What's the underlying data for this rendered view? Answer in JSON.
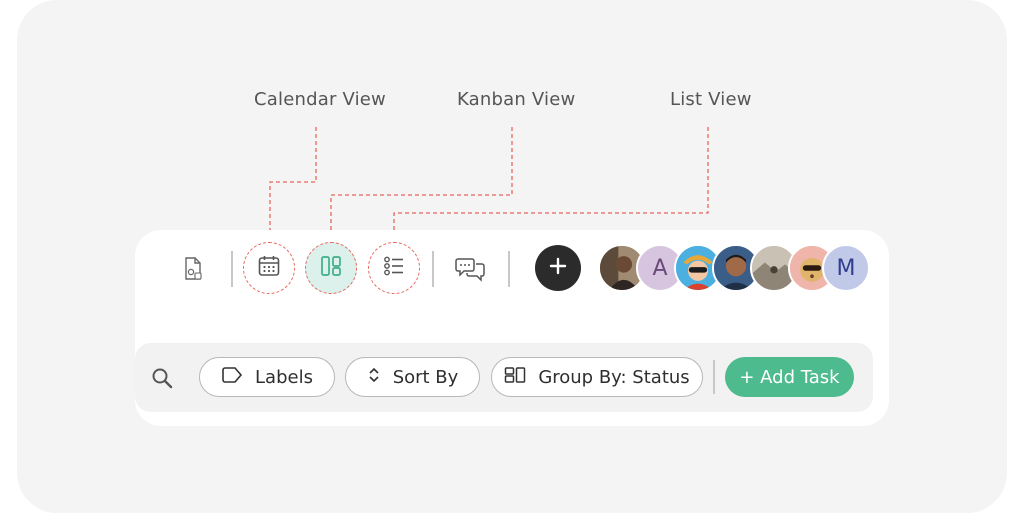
{
  "callouts": {
    "calendar": "Calendar View",
    "kanban": "Kanban View",
    "list": "List View"
  },
  "header_bar": {
    "icons": [
      "document-icon",
      "calendar-icon",
      "kanban-icon",
      "list-icon",
      "chat-icon",
      "plus-icon"
    ],
    "active_view": "kanban"
  },
  "avatars": [
    {
      "kind": "photo",
      "initial": "",
      "bg": "#7b6553"
    },
    {
      "kind": "initial",
      "initial": "A",
      "bg": "#d7c4de",
      "fg": "#6a4a7b"
    },
    {
      "kind": "photo",
      "initial": "",
      "bg": "#3fa5d6"
    },
    {
      "kind": "photo",
      "initial": "",
      "bg": "#3b5f88"
    },
    {
      "kind": "photo",
      "initial": "",
      "bg": "#b9b3a8"
    },
    {
      "kind": "photo",
      "initial": "",
      "bg": "#e6a79c"
    },
    {
      "kind": "initial",
      "initial": "M",
      "bg": "#c1c9e8",
      "fg": "#2f3e8f"
    }
  ],
  "toolbar": {
    "labels": "Labels",
    "sort_by": "Sort By",
    "group_by": "Group By: Status",
    "add_task": "+ Add Task"
  },
  "colors": {
    "accent_green": "#4dbb8d",
    "dashed_red": "#e8685f",
    "active_bg": "#dcf1ec",
    "dark_button": "#2b2b2b"
  }
}
